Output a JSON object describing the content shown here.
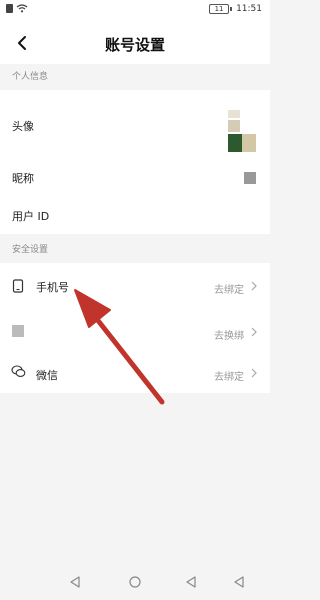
{
  "status_bar": {
    "battery": "11",
    "time": "11:51"
  },
  "header": {
    "title": "账号设置",
    "back_icon": "chevron-left-icon"
  },
  "sections": {
    "personal_label": "个人信息",
    "security_label": "安全设置"
  },
  "personal": {
    "avatar_label": "头像",
    "nickname_label": "昵称",
    "user_id_label": "用户 ID"
  },
  "security": {
    "phone_label": "手机号",
    "phone_action": "去绑定",
    "second_action": "去换绑",
    "wechat_label": "微信",
    "wechat_action": "去绑定"
  },
  "nav_bar": {
    "icons": [
      "back-triangle-icon",
      "home-circle-icon",
      "back-triangle-icon",
      "back-triangle-icon"
    ]
  },
  "annotation": {
    "color": "#c0342b"
  }
}
